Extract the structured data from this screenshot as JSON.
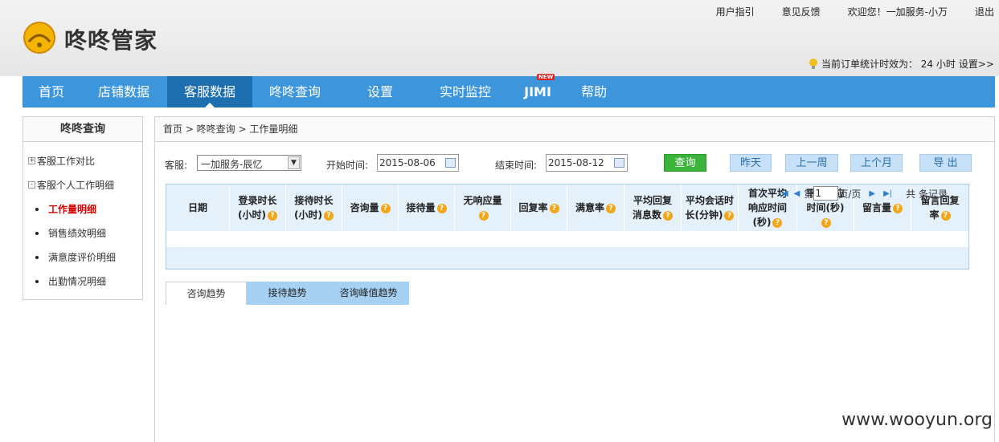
{
  "header": {
    "logo_text": "咚咚管家",
    "top_links": [
      "用户指引",
      "意见反馈",
      "欢迎您！一加服务-小万",
      "退出"
    ],
    "stat_text": "当前订单统计时效为： 24 小时",
    "stat_link": "设置>>"
  },
  "nav": {
    "items": [
      "首页",
      "店铺数据",
      "客服数据",
      "咚咚查询",
      "设置",
      "实时监控",
      "JIMI",
      "帮助"
    ],
    "active_index": 2,
    "new_badge": "NEW"
  },
  "sidebar": {
    "title": "咚咚查询",
    "groups": [
      {
        "label": "客服工作对比",
        "toggle": "+"
      },
      {
        "label": "客服个人工作明细",
        "toggle": "-"
      }
    ],
    "items": [
      "工作量明细",
      "销售绩效明细",
      "满意度评价明细",
      "出勤情况明细"
    ],
    "current_index": 0
  },
  "main": {
    "breadcrumb": "首页 > 咚咚查询 > 工作量明细",
    "filter": {
      "service_label": "客服:",
      "service_value": "一加服务-辰忆",
      "start_label": "开始时间:",
      "start_value": "2015-08-06",
      "end_label": "结束时间:",
      "end_value": "2015-08-12"
    },
    "buttons": {
      "query": "查询",
      "yesterday": "昨天",
      "last_week": "上一周",
      "last_month": "上个月",
      "export": "导 出"
    },
    "table": {
      "columns": [
        {
          "label": "日期",
          "help": false
        },
        {
          "label": "登录时长(小时)",
          "help": true
        },
        {
          "label": "接待时长(小时)",
          "help": true
        },
        {
          "label": "咨询量",
          "help": true
        },
        {
          "label": "接待量",
          "help": true
        },
        {
          "label": "无响应量",
          "help": true
        },
        {
          "label": "回复率",
          "help": true
        },
        {
          "label": "满意率",
          "help": true
        },
        {
          "label": "平均回复消息数",
          "help": true
        },
        {
          "label": "平均会话时长(分钟)",
          "help": true
        },
        {
          "label": "首次平均响应时间(秒)",
          "help": true
        },
        {
          "label": "平均响应时间(秒)",
          "help": true
        },
        {
          "label": "留言量",
          "help": true
        },
        {
          "label": "留言回复率",
          "help": true
        }
      ]
    },
    "pager": {
      "prefix": "第",
      "page": "1",
      "suffix": "页/页",
      "total": "共 条记录"
    },
    "tabs": [
      "咨询趋势",
      "接待趋势",
      "咨询峰值趋势"
    ],
    "active_tab": 0
  },
  "watermark": "www.wooyun.org",
  "colors": {
    "nav": "#3d96dc",
    "nav_active": "#1e6fb0",
    "current_item": "#d20000"
  }
}
